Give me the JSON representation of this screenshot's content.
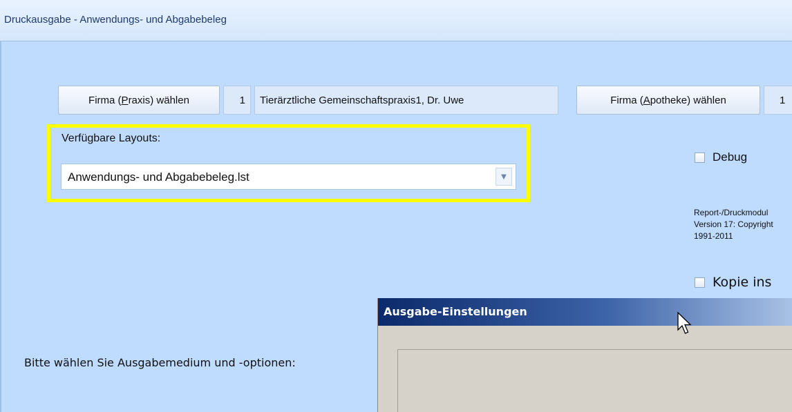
{
  "window": {
    "title": "Druckausgabe - Anwendungs- und Abgabebeleg"
  },
  "firma_praxis": {
    "button_pre": "Firma (",
    "button_mnemonic": "P",
    "button_post": "raxis) wählen",
    "number": "1",
    "name": "Tierärztliche Gemeinschaftspraxis1, Dr. Uwe"
  },
  "firma_apotheke": {
    "button_pre": "Firma (",
    "button_mnemonic": "A",
    "button_post": "potheke) wählen",
    "number": "1"
  },
  "layouts": {
    "label": "Verfügbare Layouts:",
    "selected": "Anwendungs- und Abgabebeleg.lst"
  },
  "debug": {
    "label": "Debug",
    "checked": false
  },
  "report_info": {
    "line1": "Report-/Druckmodul",
    "line2": "Version 17: Copyright",
    "line3": "1991-2011"
  },
  "kopie": {
    "label": "Kopie ins",
    "checked": false
  },
  "dialog": {
    "title": "Ausgabe-Einstellungen",
    "prompt": "Bitte wählen Sie Ausgabemedium und -optionen:"
  },
  "colors": {
    "background": "#bfdbfe",
    "highlight": "#ffff00",
    "dialog_title_start": "#0b2a6b"
  }
}
